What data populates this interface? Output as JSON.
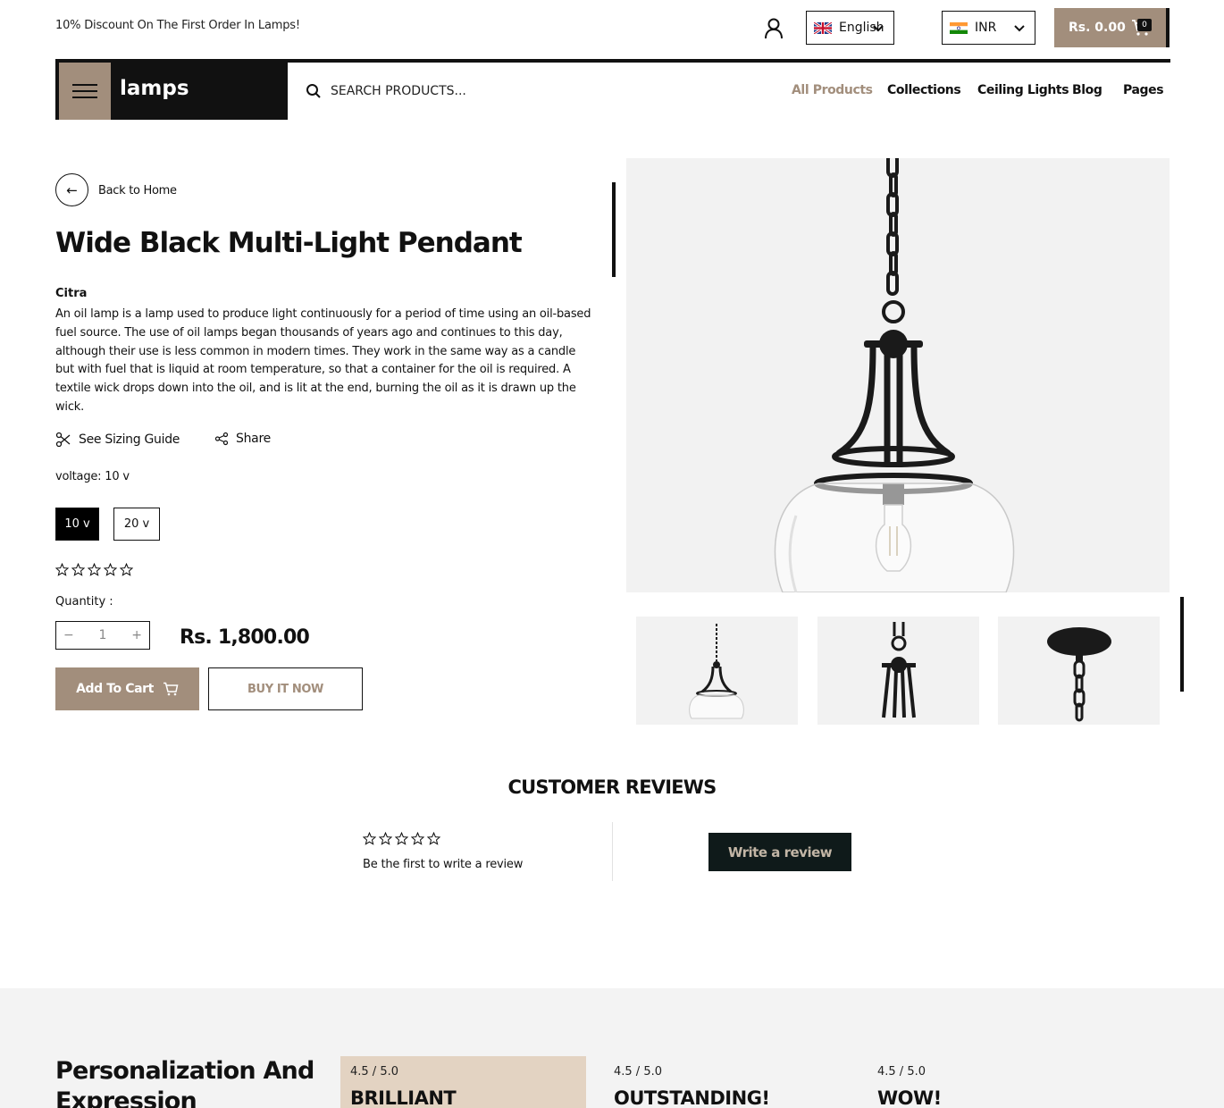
{
  "topbar": {
    "promo": "10% Discount On The First Order In Lamps!",
    "language": "English",
    "currency": "INR",
    "cart_total": "Rs. 0.00",
    "cart_count": "0"
  },
  "header": {
    "brand": "lamps",
    "search_placeholder": "SEARCH PRODUCTS...",
    "nav": [
      "All Products",
      "Collections",
      "Ceiling Lights",
      "Blog",
      "Pages"
    ]
  },
  "product": {
    "back_label": "Back to Home",
    "title": "Wide Black Multi-Light Pendant",
    "vendor": "Citra",
    "description": "An oil lamp is a lamp used to produce light continuously for a period of time using an oil-based fuel source. The use of oil lamps began thousands of years ago and continues to this day, although their use is less common in modern times. They work in the same way as a candle but with fuel that is liquid at room temperature, so that a container for the oil is required. A textile wick drops down into the oil, and is lit at the end, burning the oil as it is drawn up the wick.",
    "sizing_guide": "See Sizing Guide",
    "share": "Share",
    "voltage_label": "voltage: 10 v",
    "variants": [
      "10 v",
      "20 v"
    ],
    "rating": 0,
    "quantity_label": "Quantity :",
    "quantity": "1",
    "price": "Rs. 1,800.00",
    "add_to_cart": "Add To Cart",
    "buy_now": "BUY IT NOW"
  },
  "reviews": {
    "title": "CUSTOMER REVIEWS",
    "empty_text": "Be the first to write a review",
    "write_button": "Write a review"
  },
  "testimonials": {
    "heading": "Personalization And Expression",
    "cards": [
      {
        "score": "4.5 / 5.0",
        "quote": "BRILLIANT"
      },
      {
        "score": "4.5 / 5.0",
        "quote": "OUTSTANDING!"
      },
      {
        "score": "4.5 / 5.0",
        "quote": "WOW!"
      }
    ]
  },
  "colors": {
    "accent": "#a28e7c",
    "dark": "#111111",
    "image_bg": "#f2f2f2",
    "highlight": "#e3d3c2"
  }
}
